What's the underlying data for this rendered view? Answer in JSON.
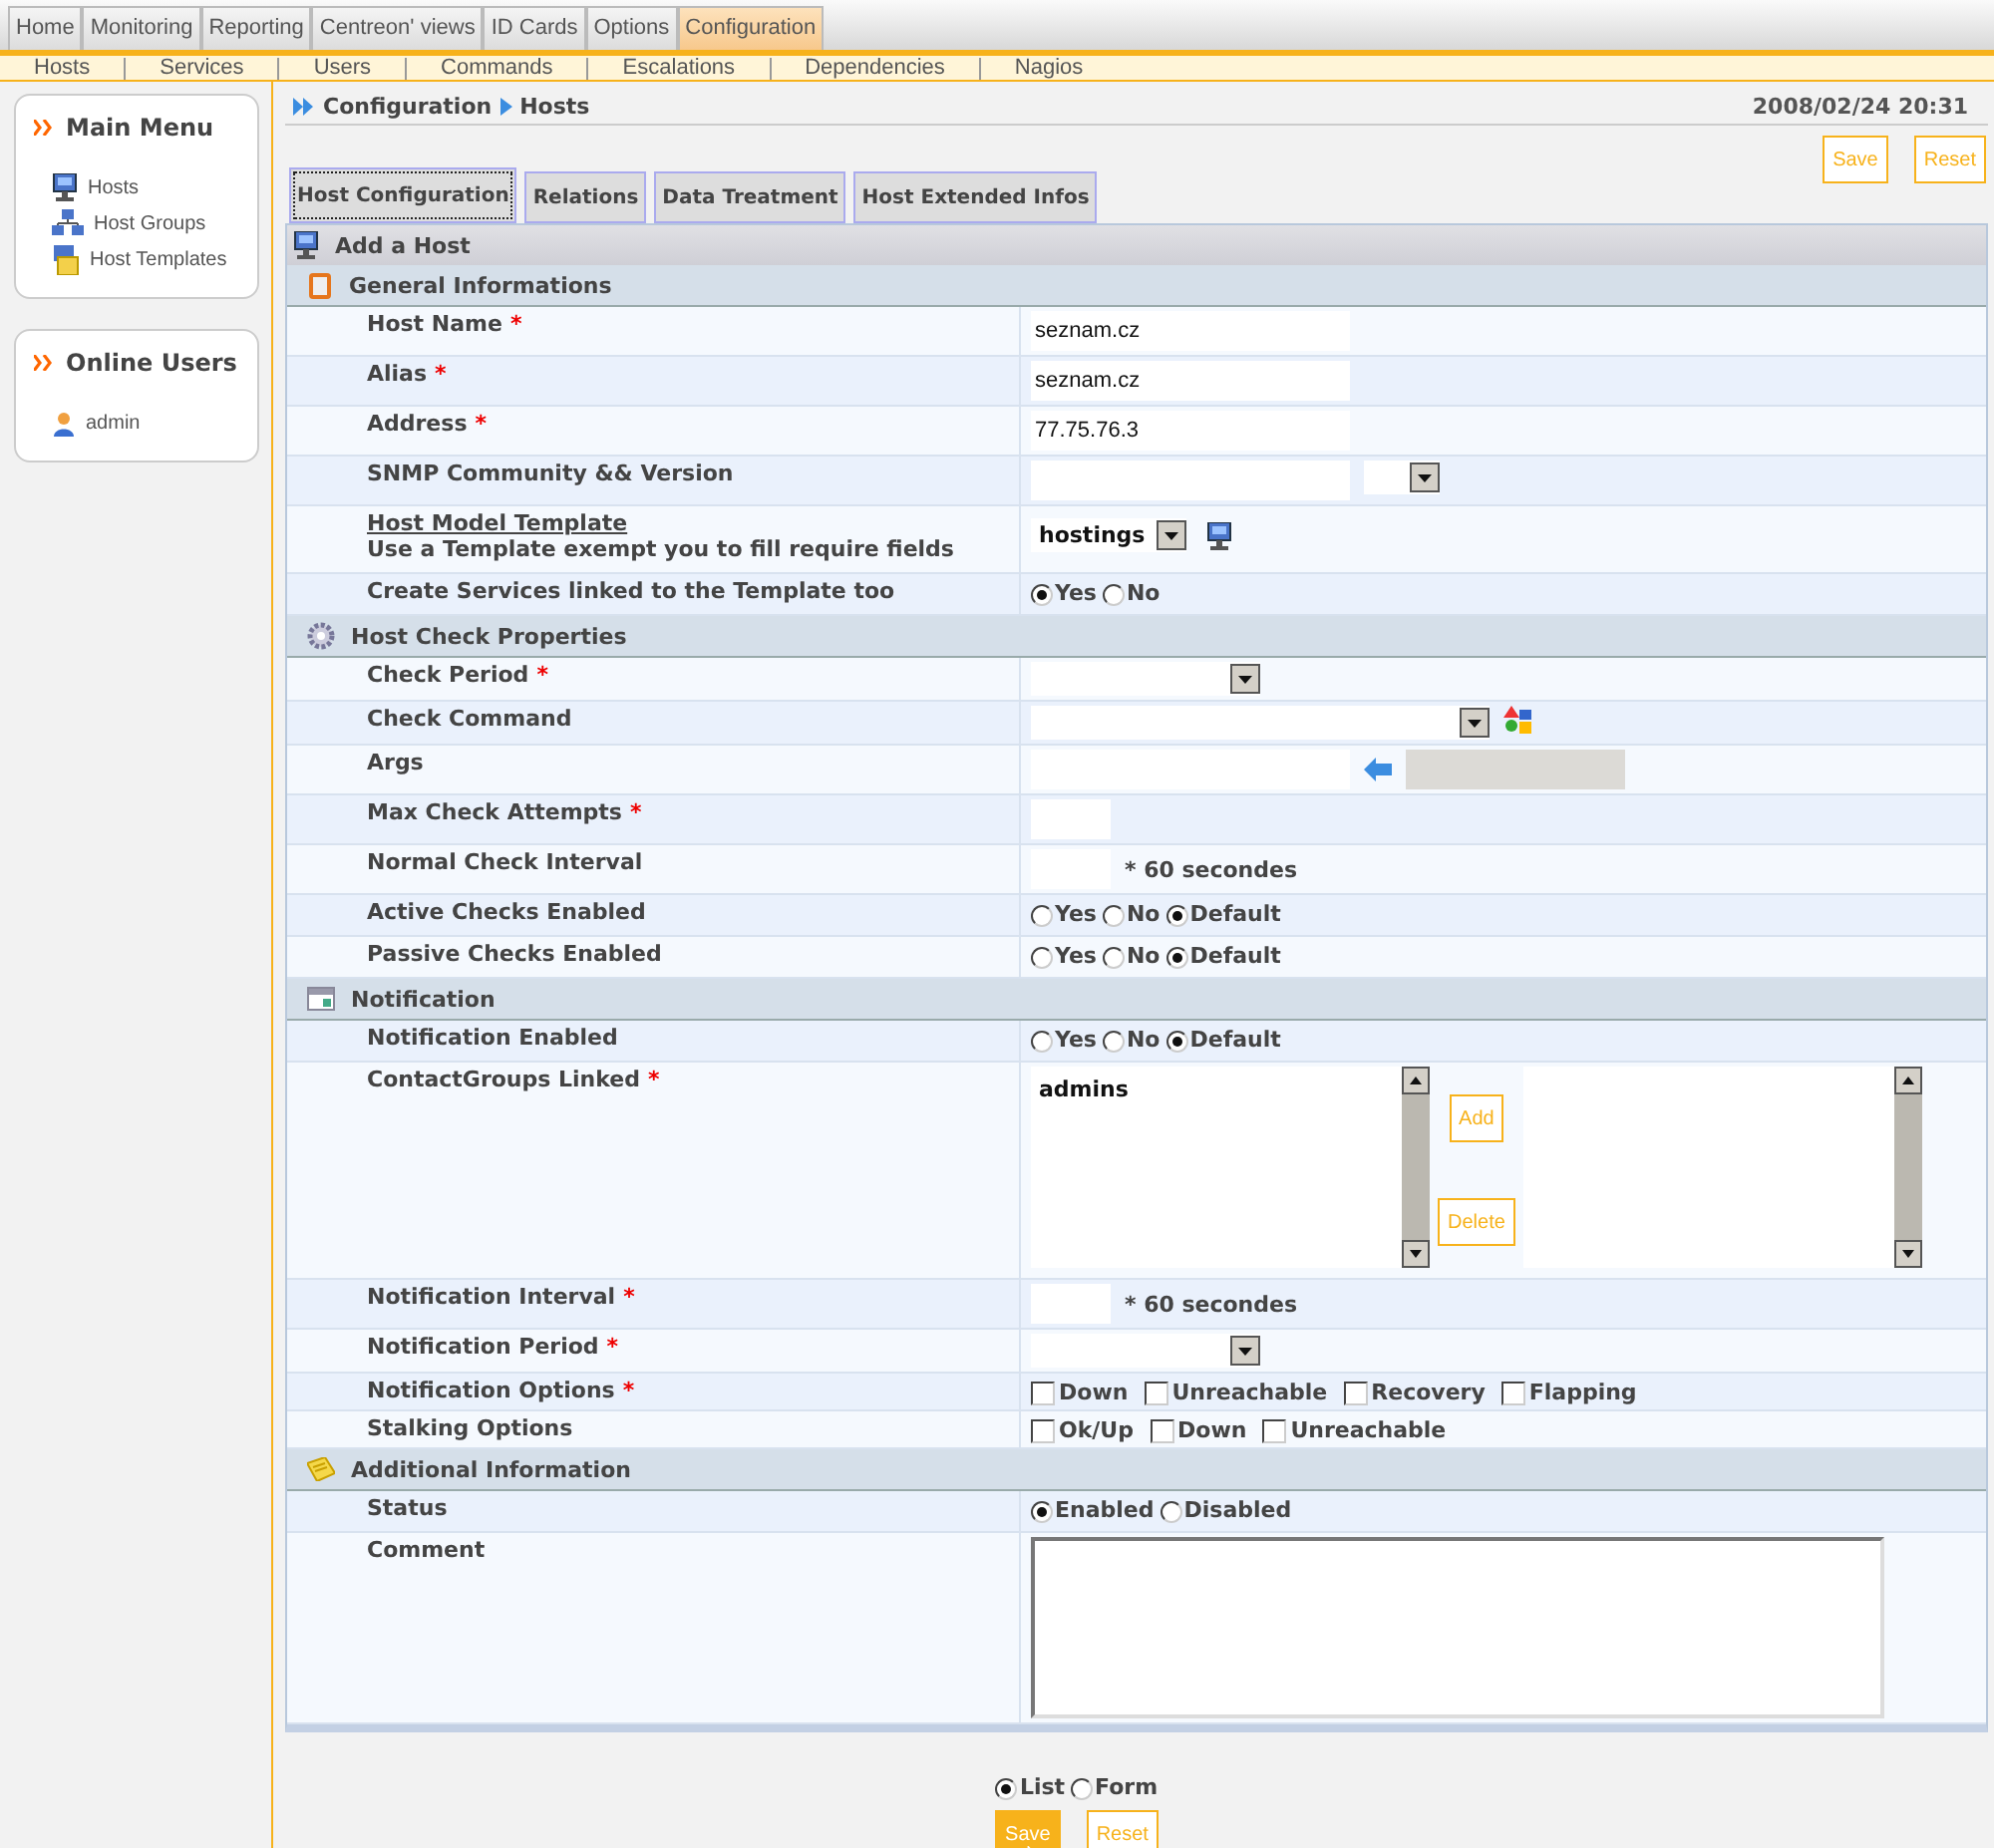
{
  "top_menu": [
    {
      "label": "Home",
      "selected": false
    },
    {
      "label": "Monitoring",
      "selected": false
    },
    {
      "label": "Reporting",
      "selected": false
    },
    {
      "label": "Centreon' views",
      "selected": false
    },
    {
      "label": "ID Cards",
      "selected": false
    },
    {
      "label": "Options",
      "selected": false
    },
    {
      "label": "Configuration",
      "selected": true
    }
  ],
  "sub_menu": [
    "Hosts",
    "Services",
    "Users",
    "Commands",
    "Escalations",
    "Dependencies",
    "Nagios"
  ],
  "sidebar": [
    {
      "title": "Main Menu",
      "items": [
        "Hosts",
        "Host Groups",
        "Host Templates"
      ]
    },
    {
      "title": "Online Users",
      "items": [
        "admin"
      ]
    }
  ],
  "breadcrumb": [
    "Configuration",
    "Hosts"
  ],
  "datetime": "2008/02/24 20:31",
  "top_buttons": [
    "Save",
    "Reset"
  ],
  "tabs": [
    {
      "label": "Host Configuration",
      "selected": true
    },
    {
      "label": "Relations",
      "selected": false
    },
    {
      "label": "Data Treatment",
      "selected": false
    },
    {
      "label": "Host Extended Infos",
      "selected": false
    }
  ],
  "form_title": "Add a Host",
  "sections": [
    {
      "title": "General Informations",
      "rows": [
        {
          "kind": "text",
          "label": "Host Name",
          "mark": "*",
          "value": "seznam.cz"
        },
        {
          "kind": "text",
          "label": "Alias",
          "mark": "*",
          "value": "seznam.cz"
        },
        {
          "kind": "text",
          "label": "Address",
          "mark": "*",
          "value": "77.75.76.3"
        },
        {
          "kind": "text_select",
          "label": "SNMP Community && Version"
        },
        {
          "kind": "template",
          "label": "Host Model Template",
          "hint": "Use a Template exempt you to fill require fields",
          "value": "hostings"
        },
        {
          "kind": "radio",
          "label": "Create Services linked to the Template too",
          "options": [
            {
              "label": "Yes",
              "selected": true
            },
            {
              "label": "No",
              "selected": false
            }
          ]
        }
      ]
    },
    {
      "title": "Host Check Properties",
      "rows": [
        {
          "kind": "select",
          "label": "Check Period",
          "mark": "*"
        },
        {
          "kind": "command",
          "label": "Check Command"
        },
        {
          "kind": "args",
          "label": "Args"
        },
        {
          "kind": "number",
          "label": "Max Check Attempts",
          "mark": "*"
        },
        {
          "kind": "number",
          "label": "Normal Check Interval",
          "suffix": "* 60 secondes"
        },
        {
          "kind": "radio",
          "label": "Active Checks Enabled",
          "options": [
            {
              "label": "Yes",
              "selected": false
            },
            {
              "label": "No",
              "selected": false
            },
            {
              "label": "Default",
              "selected": true
            }
          ]
        },
        {
          "kind": "radio",
          "label": "Passive Checks Enabled",
          "options": [
            {
              "label": "Yes",
              "selected": false
            },
            {
              "label": "No",
              "selected": false
            },
            {
              "label": "Default",
              "selected": true
            }
          ]
        }
      ]
    },
    {
      "title": "Notification",
      "rows": [
        {
          "kind": "radio",
          "label": "Notification Enabled",
          "options": [
            {
              "label": "Yes",
              "selected": false
            },
            {
              "label": "No",
              "selected": false
            },
            {
              "label": "Default",
              "selected": true
            }
          ]
        },
        {
          "kind": "listbox",
          "label": "ContactGroups Linked",
          "mark": "*",
          "items": [
            "admins"
          ],
          "buttons": [
            "Add",
            "Delete"
          ]
        },
        {
          "kind": "number",
          "label": "Notification Interval",
          "mark": "*",
          "suffix": "* 60 secondes"
        },
        {
          "kind": "select",
          "label": "Notification Period",
          "mark": "*"
        },
        {
          "kind": "checks",
          "label": "Notification Options",
          "mark": "*",
          "options": [
            {
              "label": "Down",
              "checked": false
            },
            {
              "label": "Unreachable",
              "checked": false
            },
            {
              "label": "Recovery",
              "checked": false
            },
            {
              "label": "Flapping",
              "checked": false
            }
          ]
        },
        {
          "kind": "checks",
          "label": "Stalking Options",
          "options": [
            {
              "label": "Ok/Up",
              "checked": false
            },
            {
              "label": "Down",
              "checked": false
            },
            {
              "label": "Unreachable",
              "checked": false
            }
          ]
        }
      ]
    },
    {
      "title": "Additional Information",
      "rows": [
        {
          "kind": "radio",
          "label": "Status",
          "options": [
            {
              "label": "Enabled",
              "selected": true
            },
            {
              "label": "Disabled",
              "selected": false
            }
          ]
        },
        {
          "kind": "textarea",
          "label": "Comment"
        }
      ]
    }
  ],
  "footer_radios": [
    {
      "label": "List",
      "selected": true
    },
    {
      "label": "Form",
      "selected": false
    }
  ],
  "footer_buttons": [
    {
      "label": "Save",
      "hovered": true
    },
    {
      "label": "Reset",
      "hovered": false
    }
  ]
}
